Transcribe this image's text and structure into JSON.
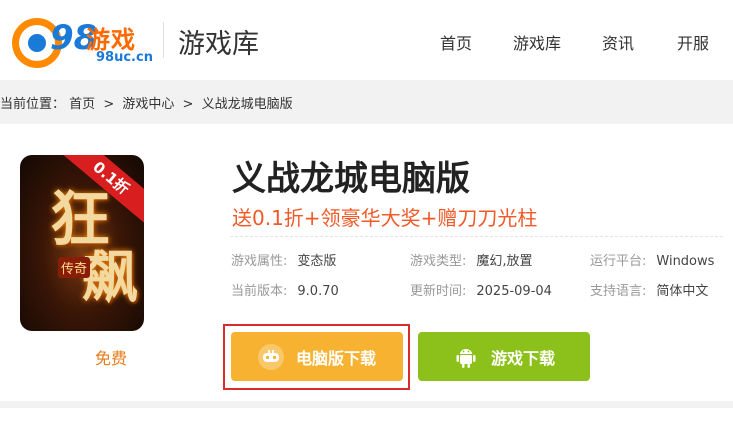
{
  "header": {
    "logo_number": "98",
    "logo_brand": "游戏",
    "logo_domain": "98uc.cn",
    "site_title": "游戏库",
    "nav": [
      "首页",
      "游戏库",
      "资讯",
      "开服"
    ]
  },
  "breadcrumb": {
    "prefix": "当前位置：",
    "items": [
      "首页",
      "游戏中心",
      "义战龙城电脑版"
    ],
    "separator": ">"
  },
  "game": {
    "cover_ribbon": "0.1折",
    "cover_glyph1": "狂",
    "cover_glyph2": "飙",
    "cover_small": "传奇",
    "price_label": "免费",
    "title": "义战龙城电脑版",
    "promo": "送0.1折+领豪华大奖+赠刀刀光柱",
    "info": [
      [
        {
          "key": "游戏属性:",
          "value": "变态版"
        },
        {
          "key": "游戏类型:",
          "value": "魔幻,放置"
        },
        {
          "key": "运行平台:",
          "value": "Windows"
        }
      ],
      [
        {
          "key": "当前版本:",
          "value": "9.0.70"
        },
        {
          "key": "更新时间:",
          "value": "2025-09-04"
        },
        {
          "key": "支持语言:",
          "value": "简体中文"
        }
      ]
    ],
    "btn_pc": "电脑版下载",
    "btn_mobile": "游戏下载"
  },
  "colors": {
    "accent_orange": "#f7b232",
    "accent_green": "#8cc11b",
    "promo_red": "#f05a28",
    "highlight_outline": "#d92d2d"
  },
  "icons": [
    "gamepad-icon",
    "android-icon"
  ]
}
